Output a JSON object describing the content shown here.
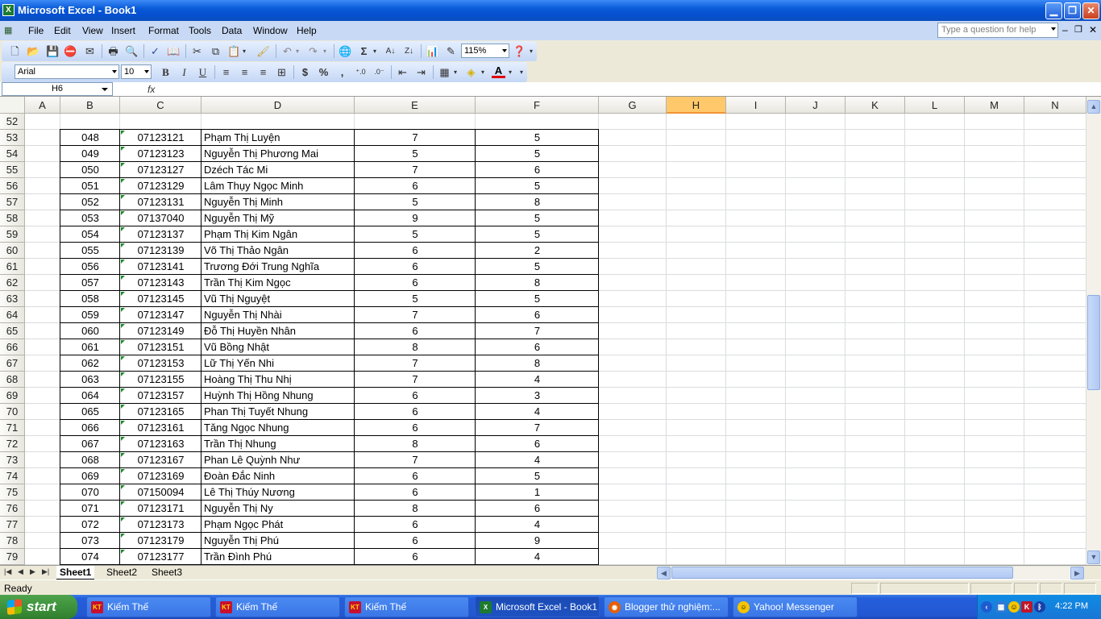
{
  "window": {
    "title": "Microsoft Excel - Book1",
    "min_label": "_",
    "max_label": "❐",
    "close_label": "✕"
  },
  "menu": [
    "File",
    "Edit",
    "View",
    "Insert",
    "Format",
    "Tools",
    "Data",
    "Window",
    "Help"
  ],
  "ask_placeholder": "Type a question for help",
  "doc_controls": [
    "–",
    "❐",
    "✕"
  ],
  "toolbar": {
    "zoom": "115%",
    "font_name": "Arial",
    "font_size": "10"
  },
  "formula": {
    "name_box": "H6",
    "fx": "fx",
    "content": ""
  },
  "columns": [
    "A",
    "B",
    "C",
    "D",
    "E",
    "F",
    "G",
    "H",
    "I",
    "J",
    "K",
    "L",
    "M",
    "N"
  ],
  "selected_column": "H",
  "first_row": 52,
  "rows": [
    [
      "048",
      "07123121",
      "Phạm Thị Luyện",
      "7",
      "5"
    ],
    [
      "049",
      "07123123",
      "Nguyễn Thị Phương Mai",
      "5",
      "5"
    ],
    [
      "050",
      "07123127",
      "Dzéch Tác Mi",
      "7",
      "6"
    ],
    [
      "051",
      "07123129",
      "Lâm Thụy Ngọc Minh",
      "6",
      "5"
    ],
    [
      "052",
      "07123131",
      "Nguyễn Thị Minh",
      "5",
      "8"
    ],
    [
      "053",
      "07137040",
      "Nguyễn Thị Mỹ",
      "9",
      "5"
    ],
    [
      "054",
      "07123137",
      "Phạm Thị Kim Ngân",
      "5",
      "5"
    ],
    [
      "055",
      "07123139",
      "Võ Thị Thảo Ngân",
      "6",
      "2"
    ],
    [
      "056",
      "07123141",
      "Trương Đới Trung Nghĩa",
      "6",
      "5"
    ],
    [
      "057",
      "07123143",
      "Trần Thị Kim Ngọc",
      "6",
      "8"
    ],
    [
      "058",
      "07123145",
      "Vũ Thị Nguyệt",
      "5",
      "5"
    ],
    [
      "059",
      "07123147",
      "Nguyễn Thị Nhài",
      "7",
      "6"
    ],
    [
      "060",
      "07123149",
      "Đỗ Thị Huyền Nhân",
      "6",
      "7"
    ],
    [
      "061",
      "07123151",
      "Vũ Bồng Nhật",
      "8",
      "6"
    ],
    [
      "062",
      "07123153",
      "Lữ Thị Yến Nhi",
      "7",
      "8"
    ],
    [
      "063",
      "07123155",
      "Hoàng Thị Thu Nhị",
      "7",
      "4"
    ],
    [
      "064",
      "07123157",
      "Huỳnh Thị Hồng Nhung",
      "6",
      "3"
    ],
    [
      "065",
      "07123165",
      "Phan Thị Tuyết Nhung",
      "6",
      "4"
    ],
    [
      "066",
      "07123161",
      "Tăng Ngọc Nhung",
      "6",
      "7"
    ],
    [
      "067",
      "07123163",
      "Trần Thị Nhung",
      "8",
      "6"
    ],
    [
      "068",
      "07123167",
      "Phan Lê Quỳnh Như",
      "7",
      "4"
    ],
    [
      "069",
      "07123169",
      "Đoàn Đắc Ninh",
      "6",
      "5"
    ],
    [
      "070",
      "07150094",
      "Lê Thị Thúy Nương",
      "6",
      "1"
    ],
    [
      "071",
      "07123171",
      "Nguyễn Thị Ny",
      "8",
      "6"
    ],
    [
      "072",
      "07123173",
      "Phạm Ngọc Phát",
      "6",
      "4"
    ],
    [
      "073",
      "07123179",
      "Nguyễn Thị Phú",
      "6",
      "9"
    ],
    [
      "074",
      "07123177",
      "Trần Đình Phú",
      "6",
      "4"
    ]
  ],
  "sheets": [
    "Sheet1",
    "Sheet2",
    "Sheet3"
  ],
  "active_sheet": "Sheet1",
  "status": "Ready",
  "taskbar": {
    "start": "start",
    "tasks": [
      "Kiếm Thế",
      "Kiếm Thế",
      "Kiếm Thế",
      "Microsoft Excel - Book1",
      "Blogger thử nghiệm:...",
      "Yahoo! Messenger"
    ],
    "clock": "4:22 PM"
  }
}
